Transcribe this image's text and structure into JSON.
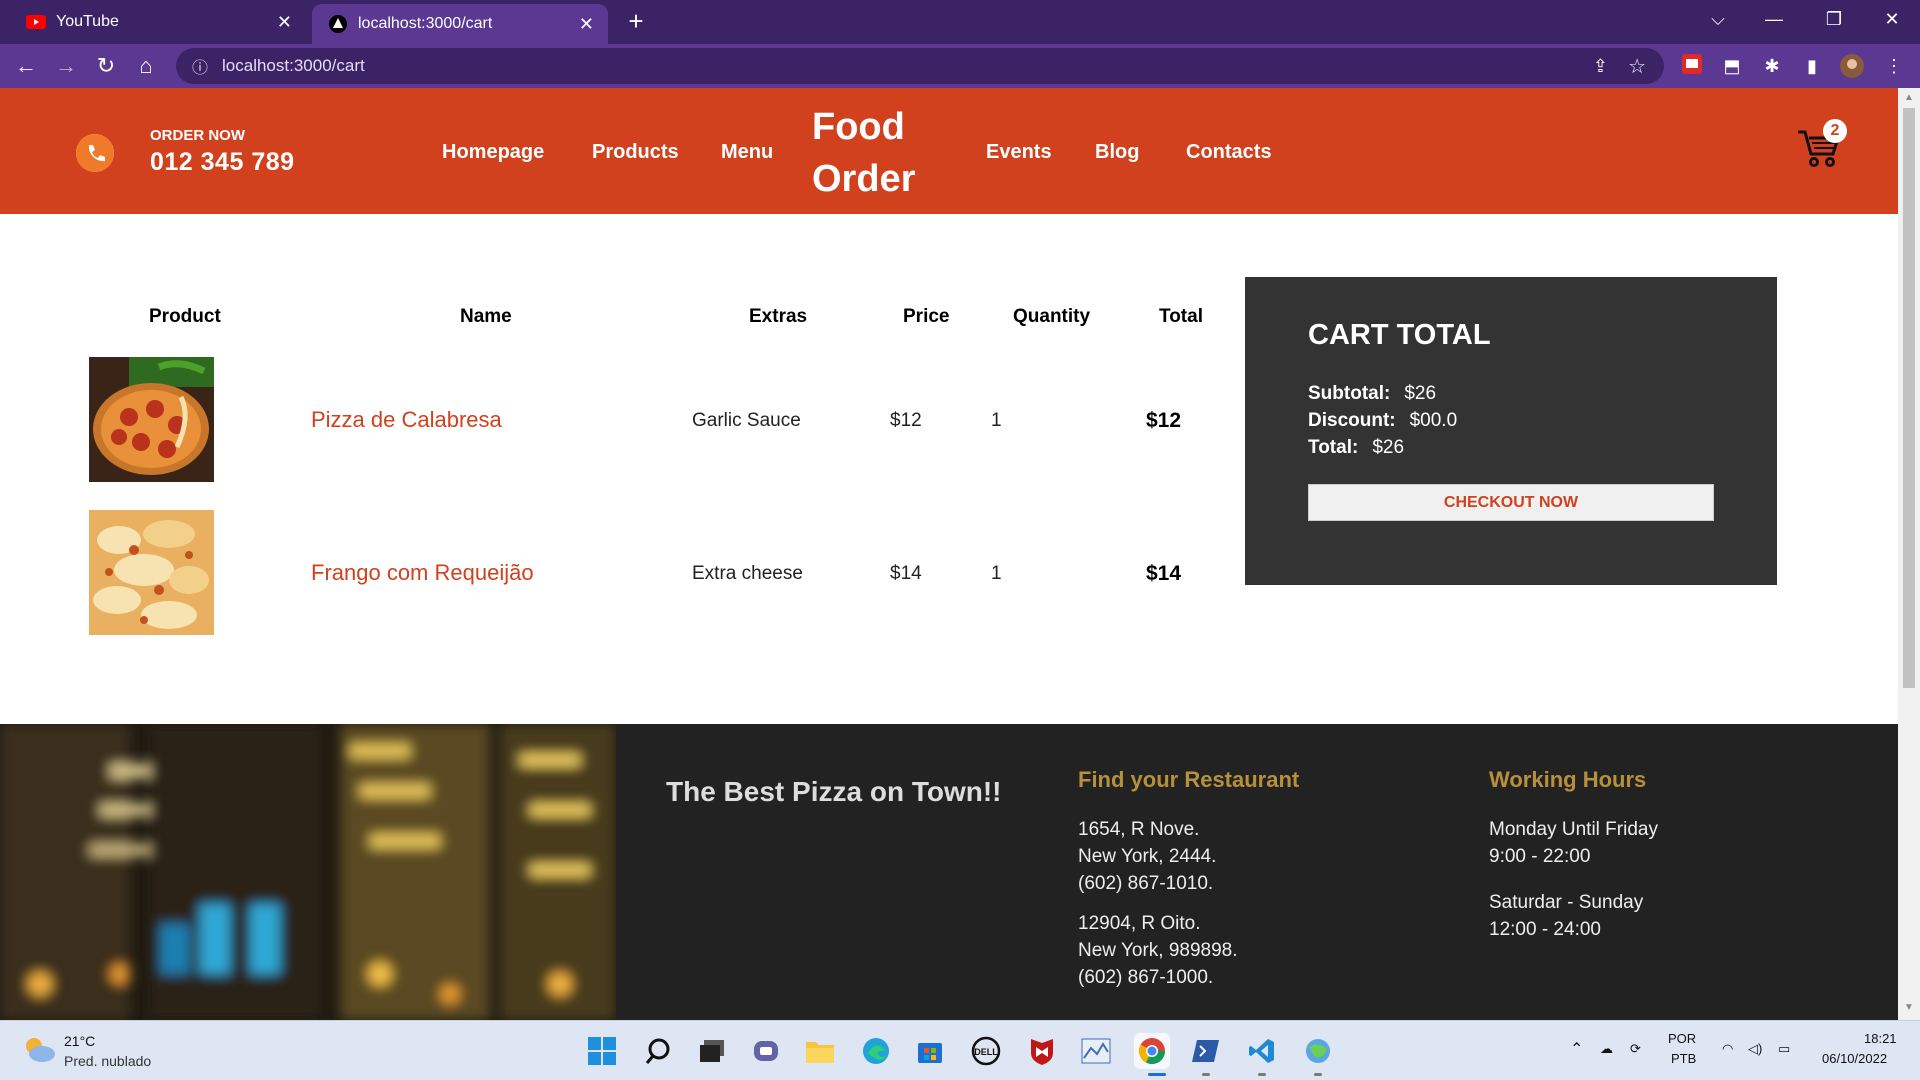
{
  "browser": {
    "tabs": [
      {
        "title": "YouTube",
        "active": false
      },
      {
        "title": "localhost:3000/cart",
        "active": true
      }
    ],
    "url": "localhost:3000/cart"
  },
  "header": {
    "order_label": "ORDER NOW",
    "phone": "012 345 789",
    "nav_left": [
      "Homepage",
      "Products",
      "Menu"
    ],
    "logo": "Food Order",
    "nav_right": [
      "Events",
      "Blog",
      "Contacts"
    ],
    "cart_count": "2",
    "accent_color": "#d1411e"
  },
  "cart": {
    "columns": [
      "Product",
      "Name",
      "Extras",
      "Price",
      "Quantity",
      "Total"
    ],
    "rows": [
      {
        "name": "Pizza de Calabresa",
        "extras": "Garlic Sauce",
        "price": "$12",
        "quantity": "1",
        "total": "$12"
      },
      {
        "name": "Frango com Requeijão",
        "extras": "Extra cheese",
        "price": "$14",
        "quantity": "1",
        "total": "$14"
      }
    ]
  },
  "cart_total": {
    "title": "CART TOTAL",
    "subtotal_label": "Subtotal:",
    "subtotal": "$26",
    "discount_label": "Discount:",
    "discount": "$00.0",
    "total_label": "Total:",
    "total": "$26",
    "checkout_label": "CHECKOUT NOW"
  },
  "footer": {
    "slogan": "The Best Pizza on Town!!",
    "restaurant_heading": "Find your Restaurant",
    "restaurants": [
      [
        "1654, R Nove.",
        "New York, 2444.",
        "(602) 867-1010."
      ],
      [
        "12904, R Oito.",
        "New York, 989898.",
        "(602) 867-1000."
      ]
    ],
    "hours_heading": "Working Hours",
    "hours": [
      [
        "Monday Until Friday",
        "9:00 - 22:00"
      ],
      [
        "Saturdar - Sunday",
        "12:00 - 24:00"
      ]
    ]
  },
  "taskbar": {
    "weather_temp": "21°C",
    "weather_desc": "Pred. nublado",
    "lang": "POR",
    "layout": "PTB",
    "time": "18:21",
    "date": "06/10/2022"
  }
}
